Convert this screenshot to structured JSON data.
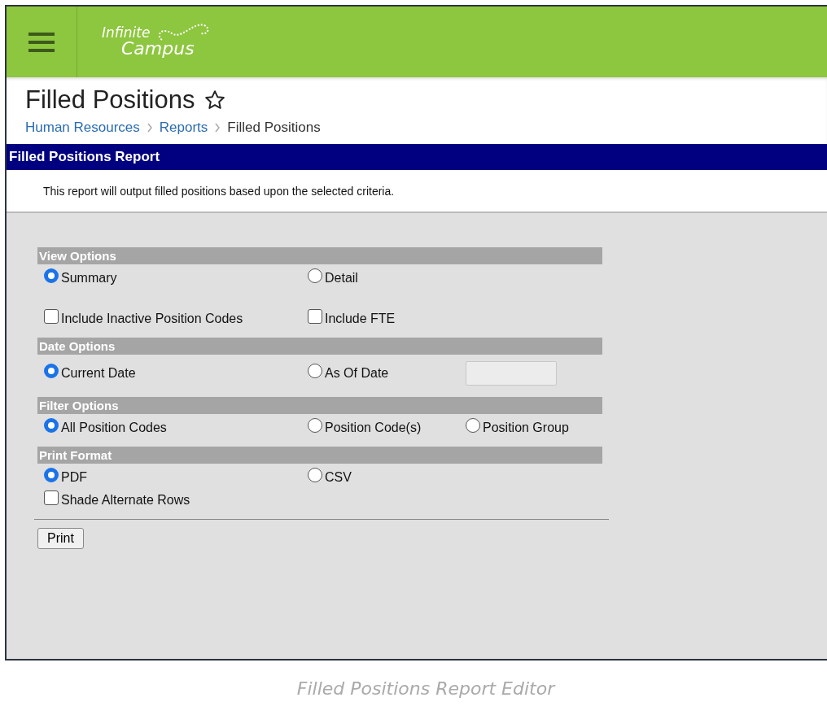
{
  "header": {
    "logo": {
      "line_1": "Infinite",
      "line_2": "Campus"
    }
  },
  "page": {
    "title": "Filled Positions",
    "favorite": false,
    "breadcrumbs": [
      {
        "label": "Human Resources",
        "kind": "link"
      },
      {
        "label": "Reports",
        "kind": "link"
      },
      {
        "label": "Filled Positions",
        "kind": "current"
      }
    ]
  },
  "report": {
    "title": "Filled Positions Report",
    "description": "This report will output filled positions based upon the selected criteria.",
    "sections": [
      {
        "title": "View Options",
        "rows": [
          [
            {
              "kind": "radio",
              "label": "Summary",
              "selected": true
            },
            {
              "kind": "radio",
              "label": "Detail",
              "selected": false
            }
          ],
          [
            {
              "kind": "checkbox",
              "label": "Include Inactive Position Codes",
              "checked": false
            },
            {
              "kind": "checkbox",
              "label": "Include FTE",
              "checked": false
            }
          ]
        ]
      },
      {
        "title": "Date Options",
        "rows": [
          [
            {
              "kind": "radio",
              "label": "Current Date",
              "selected": true
            },
            {
              "kind": "radio",
              "label": "As Of Date",
              "selected": false
            },
            {
              "kind": "field",
              "disabled": true
            }
          ]
        ]
      },
      {
        "title": "Filter Options",
        "rows": [
          [
            {
              "kind": "radio",
              "label": "All Position Codes",
              "selected": true
            },
            {
              "kind": "radio",
              "label": "Position Code(s)",
              "selected": false
            },
            {
              "kind": "radio",
              "label": "Position Group",
              "selected": false
            }
          ]
        ]
      },
      {
        "title": "Print Format",
        "rows": [
          [
            {
              "kind": "radio",
              "label": "PDF",
              "selected": true
            },
            {
              "kind": "radio",
              "label": "CSV",
              "selected": false
            }
          ],
          [
            {
              "kind": "checkbox",
              "label": "Shade Alternate Rows",
              "checked": false
            }
          ]
        ]
      }
    ],
    "button": "Print"
  },
  "caption": "Filled Positions Report Editor"
}
